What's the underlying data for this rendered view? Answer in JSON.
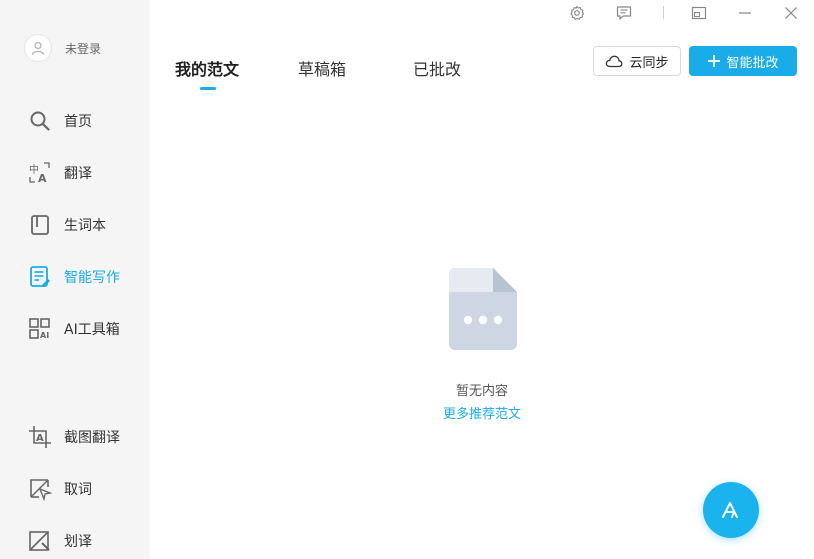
{
  "user": {
    "name": "未登录",
    "avatar_icon": "user-icon"
  },
  "sidebar": {
    "items": [
      {
        "label": "首页",
        "icon": "search-icon"
      },
      {
        "label": "翻译",
        "icon": "translate-icon"
      },
      {
        "label": "生词本",
        "icon": "book-icon"
      },
      {
        "label": "智能写作",
        "icon": "writing-icon",
        "active": true
      },
      {
        "label": "AI工具箱",
        "icon": "ai-toolbox-icon"
      },
      {
        "label": "截图翻译",
        "icon": "screenshot-translate-icon"
      },
      {
        "label": "取词",
        "icon": "word-pick-icon"
      },
      {
        "label": "划译",
        "icon": "select-translate-icon"
      }
    ]
  },
  "titlebar": {
    "buttons": [
      "settings-icon",
      "feedback-icon",
      "mini-mode-icon",
      "minimize-icon",
      "close-icon"
    ]
  },
  "tabs": [
    {
      "label": "我的范文",
      "active": true
    },
    {
      "label": "草稿箱"
    },
    {
      "label": "已批改"
    }
  ],
  "actions": {
    "cloud_sync": "云同步",
    "smart_correct": "智能批改"
  },
  "empty_state": {
    "message": "暂无内容",
    "link": "更多推荐范文"
  },
  "colors": {
    "accent": "#1aace9",
    "sidebar_bg": "#f5f5f5"
  }
}
